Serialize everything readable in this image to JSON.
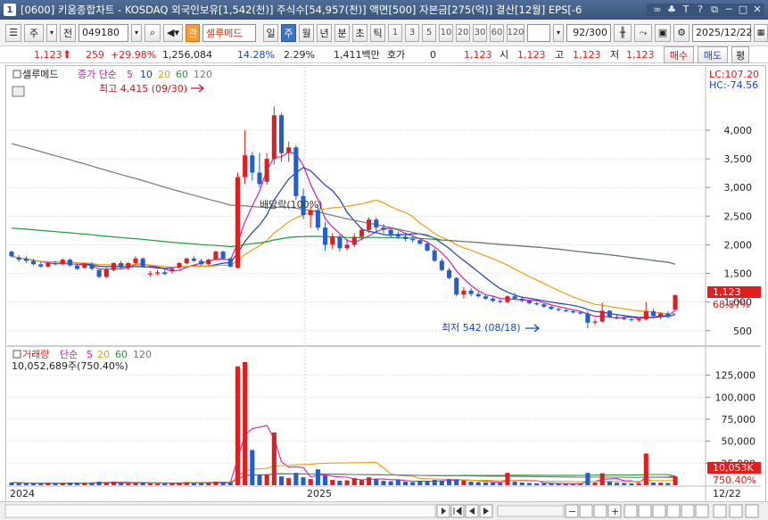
{
  "window": {
    "app_number": "1",
    "title": "[0600] 키움종합차트 - KOSDAQ 외국인보유[1,542(천)] 주식수[54,957(천)] 액면[500] 자본금[275(억)] 결산[12월] EPS[-6"
  },
  "toolbar": {
    "mode_1": "주",
    "mode_2": "전",
    "code": "049180",
    "name": "셀루메드",
    "periods": [
      "일",
      "주",
      "월",
      "년",
      "분",
      "초",
      "틱"
    ],
    "active_period": "주",
    "intervals": [
      "1",
      "3",
      "5",
      "10",
      "20",
      "30",
      "60",
      "120"
    ],
    "count": "92",
    "count_total": "/300",
    "date": "2025/12/22"
  },
  "quote": {
    "price": "1,123",
    "change": "259",
    "change_pct": "+29.98%",
    "volume": "1,256,084",
    "turnover_pct": "14.28%",
    "other_pct": "2.29%",
    "amount": "1,411백만",
    "bid_label": "호가",
    "bid_value": "0",
    "ask_value": "1,123",
    "open_label": "시",
    "open": "1,123",
    "high_label": "고",
    "high": "1,123",
    "low_label": "저",
    "low": "1,123",
    "buy_button": "매수",
    "sell_button": "매도",
    "eval_button": "평"
  },
  "price_panel": {
    "legend_name": "셀루메드",
    "legend_label": "종가 단순",
    "ma_periods": [
      "5",
      "10",
      "20",
      "60",
      "120"
    ],
    "ma_colors": [
      "#d61fb8",
      "#1a3fb8",
      "#e8a20d",
      "#1e9a3b",
      "#777777"
    ],
    "lc_label": "LC:107.20",
    "hc_label": "HC:-74.56",
    "max_annotation": "최고 4,415 (09/30)",
    "min_annotation": "최저 542 (08/18)",
    "dividend_annotation": "배당락(100%)",
    "current_price_label": "1,123",
    "current_pct_label": "68.87%"
  },
  "volume_panel": {
    "legend_label": "거래량",
    "legend_ma": "단순",
    "ma_periods": [
      "5",
      "20",
      "60",
      "120"
    ],
    "value_label": "10,052,689주(750.40%)",
    "current_label": "10,053K",
    "current_pct_label": "750.40%"
  },
  "x_axis": {
    "labels": [
      "2024",
      "2025"
    ],
    "end_label": "12/22"
  },
  "chart_data": {
    "type": "candlestick",
    "price_axis": {
      "ylim": [
        310,
        4700
      ],
      "ticks": [
        500,
        1000,
        1500,
        2000,
        2500,
        3000,
        3500,
        4000
      ]
    },
    "volume_axis": {
      "ylim": [
        0,
        150000
      ],
      "ticks": [
        25000,
        50000,
        75000,
        100000,
        125000
      ],
      "tick_unit_note": "thousand shares"
    },
    "candles": [
      [
        1880,
        1900,
        1780,
        1800
      ],
      [
        1780,
        1820,
        1700,
        1740
      ],
      [
        1760,
        1800,
        1680,
        1720
      ],
      [
        1720,
        1760,
        1640,
        1660
      ],
      [
        1660,
        1700,
        1600,
        1620
      ],
      [
        1620,
        1700,
        1600,
        1680
      ],
      [
        1680,
        1720,
        1640,
        1660
      ],
      [
        1660,
        1760,
        1650,
        1740
      ],
      [
        1740,
        1760,
        1620,
        1640
      ],
      [
        1640,
        1660,
        1560,
        1580
      ],
      [
        1600,
        1680,
        1580,
        1660
      ],
      [
        1660,
        1700,
        1560,
        1580
      ],
      [
        1560,
        1580,
        1420,
        1440
      ],
      [
        1440,
        1600,
        1420,
        1580
      ],
      [
        1560,
        1700,
        1540,
        1680
      ],
      [
        1680,
        1720,
        1580,
        1600
      ],
      [
        1600,
        1700,
        1560,
        1680
      ],
      [
        1680,
        1800,
        1640,
        1760
      ],
      [
        1760,
        1780,
        1600,
        1620
      ],
      [
        1480,
        1540,
        1440,
        1500
      ],
      [
        1500,
        1560,
        1470,
        1520
      ],
      [
        1520,
        1560,
        1470,
        1490
      ],
      [
        1540,
        1600,
        1500,
        1580
      ],
      [
        1600,
        1700,
        1580,
        1680
      ],
      [
        1680,
        1780,
        1660,
        1760
      ],
      [
        1760,
        1800,
        1700,
        1720
      ],
      [
        1720,
        1760,
        1640,
        1660
      ],
      [
        1660,
        1760,
        1640,
        1740
      ],
      [
        1740,
        1900,
        1720,
        1880
      ],
      [
        1880,
        1900,
        1740,
        1760
      ],
      [
        1760,
        1780,
        1600,
        1620
      ],
      [
        1600,
        3260,
        1580,
        3180
      ],
      [
        3180,
        4000,
        3060,
        3560
      ],
      [
        3560,
        3620,
        3120,
        3260
      ],
      [
        3260,
        3600,
        3000,
        3060
      ],
      [
        3100,
        3600,
        3050,
        3500
      ],
      [
        3500,
        4415,
        3400,
        4260
      ],
      [
        4260,
        4300,
        3450,
        3600
      ],
      [
        3600,
        3800,
        3450,
        3700
      ],
      [
        3700,
        3740,
        2780,
        2850
      ],
      [
        2850,
        2980,
        2450,
        2520
      ],
      [
        2520,
        2700,
        2300,
        2600
      ],
      [
        2600,
        2700,
        2250,
        2300
      ],
      [
        2300,
        2400,
        1900,
        2000
      ],
      [
        2000,
        2200,
        1920,
        2140
      ],
      [
        2140,
        2180,
        1880,
        1940
      ],
      [
        1940,
        2100,
        1900,
        2000
      ],
      [
        2000,
        2200,
        1960,
        2140
      ],
      [
        2140,
        2300,
        2080,
        2260
      ],
      [
        2260,
        2480,
        2200,
        2440
      ],
      [
        2440,
        2480,
        2220,
        2300
      ],
      [
        2300,
        2360,
        2200,
        2260
      ],
      [
        2260,
        2300,
        2120,
        2180
      ],
      [
        2180,
        2240,
        2100,
        2140
      ],
      [
        2140,
        2200,
        2060,
        2100
      ],
      [
        2100,
        2160,
        2040,
        2080
      ],
      [
        2080,
        2120,
        2000,
        2020
      ],
      [
        2020,
        2060,
        1880,
        1900
      ],
      [
        1900,
        1940,
        1700,
        1720
      ],
      [
        1720,
        1760,
        1540,
        1560
      ],
      [
        1560,
        1600,
        1400,
        1420
      ],
      [
        1420,
        1440,
        1100,
        1130
      ],
      [
        1130,
        1260,
        1060,
        1200
      ],
      [
        1200,
        1240,
        1100,
        1140
      ],
      [
        1140,
        1180,
        1080,
        1100
      ],
      [
        1100,
        1120,
        1040,
        1060
      ],
      [
        1060,
        1100,
        1000,
        1020
      ],
      [
        1020,
        1060,
        980,
        1000
      ],
      [
        1000,
        1120,
        980,
        1100
      ],
      [
        1100,
        1160,
        1040,
        1060
      ],
      [
        1060,
        1100,
        1000,
        1020
      ],
      [
        1020,
        1040,
        960,
        980
      ],
      [
        980,
        1000,
        940,
        960
      ],
      [
        960,
        980,
        900,
        920
      ],
      [
        920,
        940,
        860,
        880
      ],
      [
        880,
        900,
        840,
        860
      ],
      [
        860,
        880,
        820,
        840
      ],
      [
        840,
        860,
        800,
        820
      ],
      [
        820,
        840,
        780,
        800
      ],
      [
        800,
        840,
        542,
        640
      ],
      [
        640,
        700,
        600,
        660
      ],
      [
        660,
        990,
        640,
        850
      ],
      [
        850,
        860,
        720,
        740
      ],
      [
        740,
        780,
        700,
        720
      ],
      [
        720,
        760,
        680,
        700
      ],
      [
        700,
        740,
        660,
        690
      ],
      [
        690,
        720,
        650,
        700
      ],
      [
        700,
        1000,
        680,
        840
      ],
      [
        840,
        880,
        720,
        760
      ],
      [
        760,
        820,
        700,
        800
      ],
      [
        800,
        840,
        720,
        740
      ],
      [
        864,
        1123,
        864,
        1123
      ]
    ],
    "volumes": [
      3000,
      2500,
      2200,
      2000,
      1800,
      2200,
      2000,
      2500,
      3000,
      2500,
      2400,
      2800,
      4000,
      3500,
      3800,
      2600,
      2200,
      3000,
      3200,
      2000,
      1800,
      1900,
      2200,
      2800,
      3500,
      2600,
      2800,
      3200,
      4000,
      3600,
      3000,
      135000,
      140000,
      40000,
      12000,
      12500,
      60000,
      10000,
      8000,
      14000,
      9000,
      7000,
      18000,
      11000,
      6000,
      5000,
      5500,
      8000,
      6000,
      9000,
      7000,
      5000,
      4500,
      6000,
      4000,
      3500,
      5000,
      4500,
      6000,
      5500,
      7000,
      6500,
      5500,
      4000,
      3500,
      3200,
      3000,
      2800,
      14000,
      4000,
      3000,
      2500,
      2200,
      2000,
      1800,
      1700,
      1600,
      1500,
      1400,
      14000,
      3000,
      13500,
      4000,
      2800,
      2500,
      2200,
      2000,
      36000,
      3000,
      2800,
      2500,
      10053
    ]
  }
}
